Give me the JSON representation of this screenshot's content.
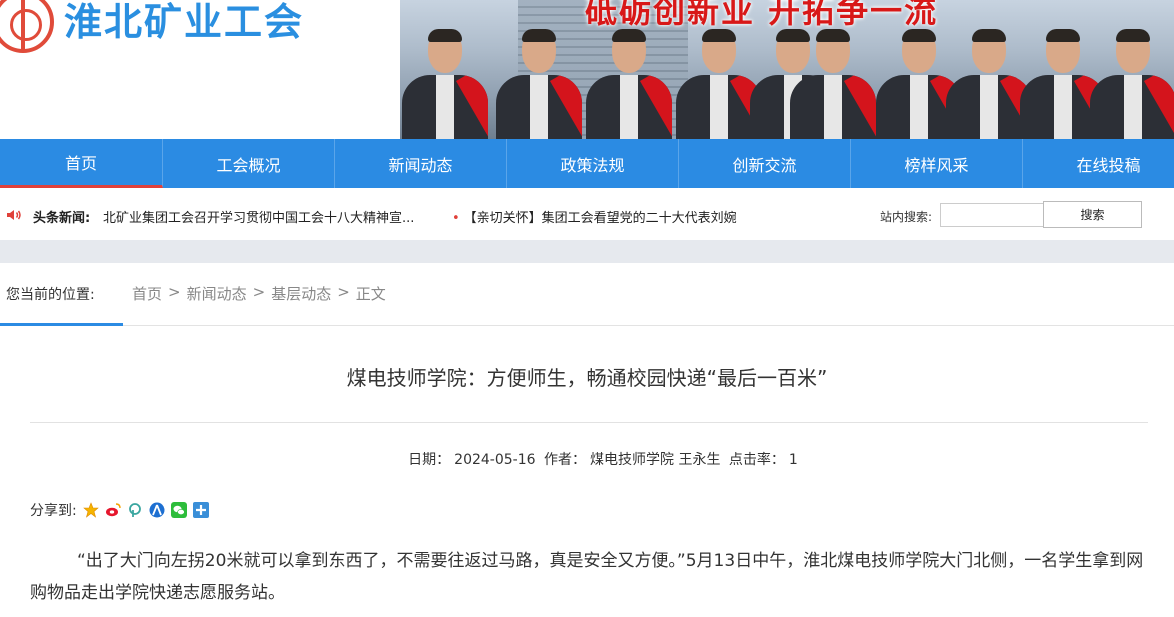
{
  "header": {
    "site_title": "淮北矿业工会",
    "banner_slogan": "砥砺创新业 开拓争一流",
    "logo_icon": "union-emblem-icon"
  },
  "nav": {
    "items": [
      {
        "label": "首页",
        "active": true
      },
      {
        "label": "工会概况"
      },
      {
        "label": "新闻动态"
      },
      {
        "label": "政策法规"
      },
      {
        "label": "创新交流"
      },
      {
        "label": "榜样风采"
      },
      {
        "label": "在线投稿"
      }
    ]
  },
  "headline": {
    "label": "头条新闻:",
    "item1": "北矿业集团工会召开学习贯彻中国工会十八大精神宣...",
    "item2": "【亲切关怀】集团工会看望党的二十大代表刘婉",
    "search_label": "站内搜索:",
    "search_value": "",
    "search_button": "搜索"
  },
  "breadcrumb": {
    "label": "您当前的位置:",
    "items": [
      "首页",
      "新闻动态",
      "基层动态",
      "正文"
    ],
    "separator": ">"
  },
  "article": {
    "title": "煤电技师学院：方便师生，畅通校园快递“最后一百米”",
    "date_label": "日期：",
    "date": "2024-05-16",
    "author_label": "作者：",
    "author": "煤电技师学院 王永生",
    "clicks_label": "点击率：",
    "clicks": "1",
    "share_label": "分享到:",
    "share_icons": [
      "qzone-icon",
      "weibo-icon",
      "pengyou-icon",
      "renren-icon",
      "wechat-icon",
      "more-share-icon"
    ],
    "paragraph": "“出了大门向左拐20米就可以拿到东西了，不需要往返过马路，真是安全又方便。”5月13日中午，淮北煤电技师学院大门北侧，一名学生拿到网购物品走出学院快递志愿服务站。"
  },
  "colors": {
    "nav_blue": "#2b8be3",
    "accent_red": "#e0413a",
    "title_blue": "#2a8fe0"
  }
}
